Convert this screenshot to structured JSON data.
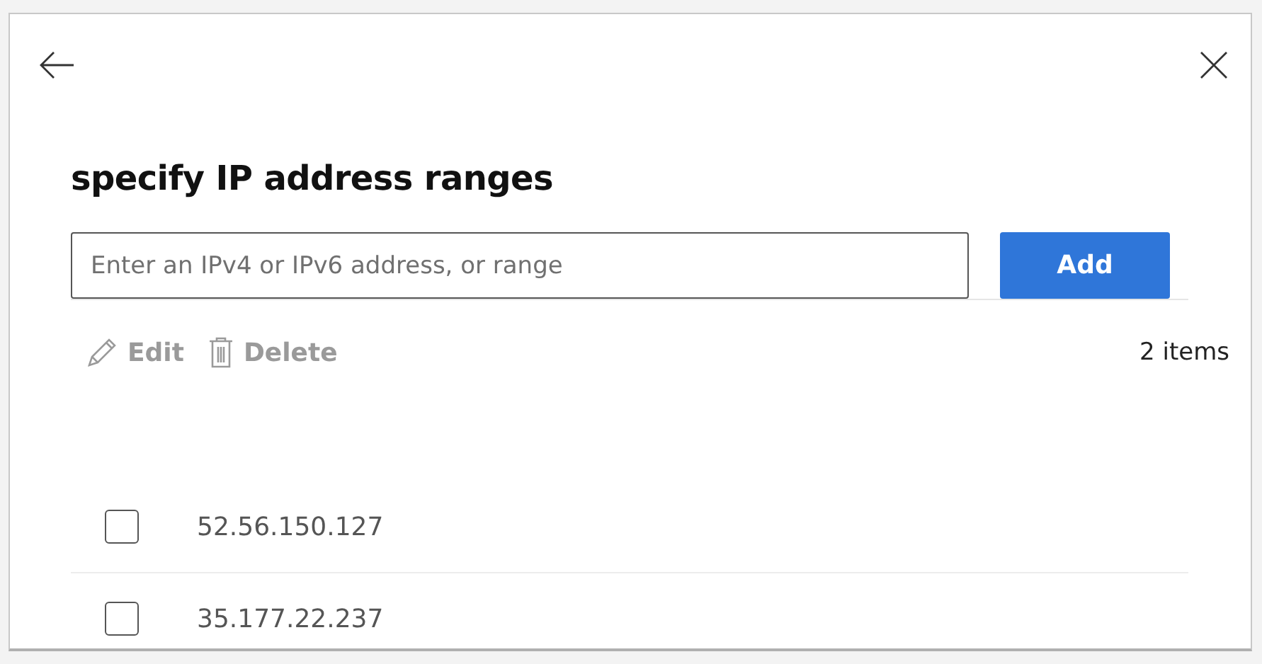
{
  "title": "specify IP address ranges",
  "input": {
    "placeholder": "Enter an IPv4 or IPv6 address, or range"
  },
  "add_button": "Add",
  "toolbar": [
    {
      "kind": "edit",
      "label": "Edit",
      "disabled": true
    },
    {
      "kind": "delete",
      "label": "Delete",
      "disabled": true
    }
  ],
  "item_count": "2 items",
  "rows": [
    {
      "address": "52.56.150.127",
      "checked": false
    },
    {
      "address": "35.177.22.237",
      "checked": false
    }
  ]
}
